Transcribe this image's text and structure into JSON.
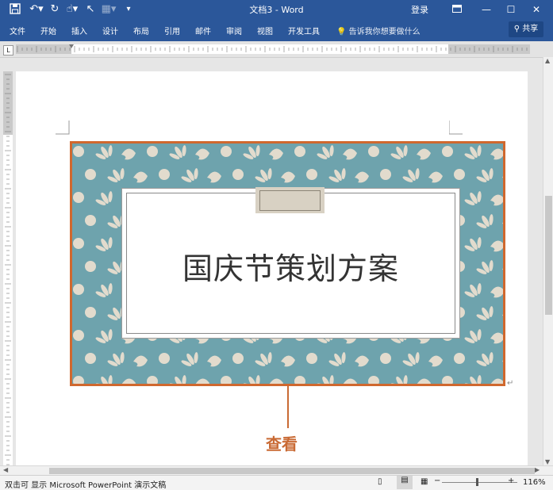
{
  "window": {
    "title": "文档3  -  Word",
    "login": "登录",
    "share": "共享"
  },
  "ribbon_tabs": [
    "文件",
    "开始",
    "插入",
    "设计",
    "布局",
    "引用",
    "邮件",
    "审阅",
    "视图",
    "开发工具"
  ],
  "tell_me": "告诉我你想要做什么",
  "ruler_corner": "L",
  "document": {
    "title": "国庆节策划方案"
  },
  "callout": {
    "label": "查看"
  },
  "status": {
    "text": "双击可 显示 Microsoft PowerPoint 演示文稿",
    "zoom": "116%"
  },
  "colors": {
    "ribbon": "#2b579a",
    "accent": "#d0682e",
    "pattern_bg": "#6ea3ad",
    "pattern_fg": "#e2dbcd"
  }
}
